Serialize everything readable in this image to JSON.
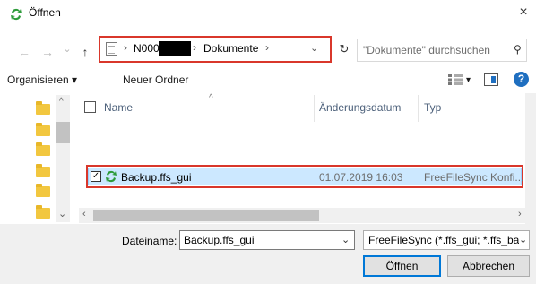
{
  "window": {
    "title": "Öffnen",
    "close_glyph": "×",
    "app_icon": "freefilesync-icon"
  },
  "navigation": {
    "back_glyph": "←",
    "forward_glyph": "→",
    "recent_glyph": "⌄",
    "up_glyph": "↑",
    "refresh_glyph": "↻",
    "breadcrumb": {
      "separator": "›",
      "items": [
        "N000",
        "Dokumente"
      ],
      "dropdown_glyph": "⌄"
    },
    "search": {
      "placeholder": "\"Dokumente\" durchsuchen",
      "value": "",
      "icon_glyph": "⚲"
    }
  },
  "toolbar": {
    "organize_label": "Organisieren ▾",
    "new_folder_label": "Neuer Ordner",
    "view_dropdown_glyph": "▾",
    "help_glyph": "?"
  },
  "file_list": {
    "columns": [
      "Name",
      "Änderungsdatum",
      "Typ"
    ],
    "sort_glyph": "^",
    "rows": [
      {
        "checked": true,
        "check_glyph": "✓",
        "name": "Backup.ffs_gui",
        "date": "01.07.2019 16:03",
        "type": "FreeFileSync Konfi...",
        "selected": true
      }
    ]
  },
  "scrollbar": {
    "left_arrow": "‹",
    "right_arrow": "›",
    "up_arrow": "^",
    "down_arrow": "⌄"
  },
  "footer": {
    "filename_label": "Dateiname:",
    "filename_value": "Backup.ffs_gui",
    "filetype_value": "FreeFileSync (*.ffs_gui; *.ffs_bat",
    "dropdown_glyph": "⌄",
    "open_label": "Öffnen",
    "cancel_label": "Abbrechen"
  },
  "colors": {
    "highlight_border": "#d9372b",
    "selection_bg": "#cce8ff",
    "accent": "#0078d7",
    "folder": "#f2c73f"
  }
}
